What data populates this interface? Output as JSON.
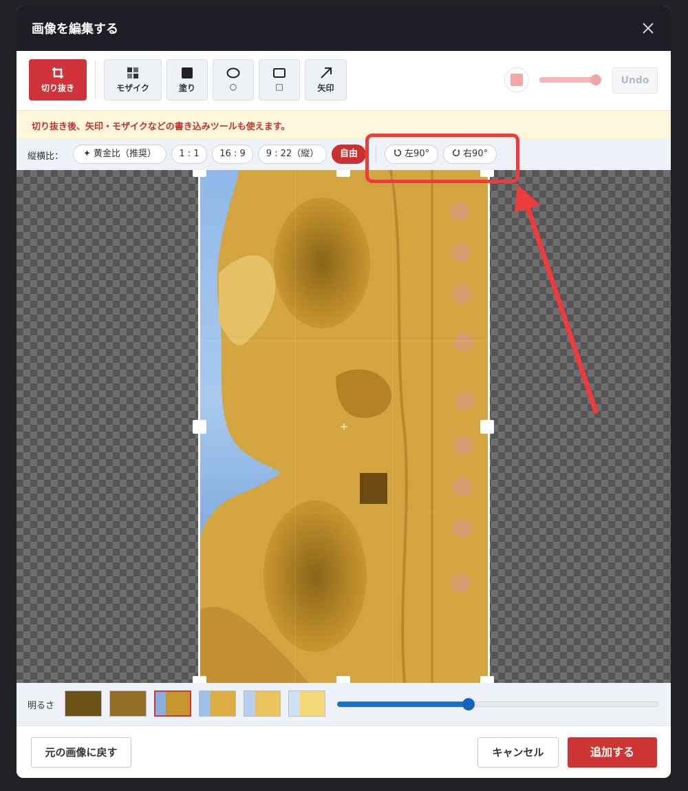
{
  "dialog": {
    "title": "画像を編集する"
  },
  "toolbar": {
    "tools": [
      {
        "label": "切り抜き",
        "icon": "crop-icon"
      },
      {
        "label": "モザイク",
        "icon": "mosaic-icon"
      },
      {
        "label": "塗り",
        "icon": "fill-icon"
      },
      {
        "label": "○",
        "icon": "ellipse-icon"
      },
      {
        "label": "□",
        "icon": "rectangle-icon"
      },
      {
        "label": "矢印",
        "icon": "arrow-icon"
      }
    ],
    "active_tool": "切り抜き",
    "color": "#f4a7a7",
    "undo_label": "Undo"
  },
  "notice": "切り抜き後、矢印・モザイクなどの書き込みツールも使えます。",
  "aspect": {
    "label": "縦横比：",
    "options": [
      "✦ 黄金比（推奨）",
      "1 : 1",
      "16 : 9",
      "9 : 22（縦）",
      "自由"
    ],
    "selected": "自由",
    "rotate_left": "左90°",
    "rotate_right": "右90°"
  },
  "brightness": {
    "label": "明るさ",
    "presets": 6,
    "selected_index": 2,
    "slider_value": 0.41
  },
  "footer": {
    "reset_label": "元の画像に戻す",
    "cancel_label": "キャンセル",
    "add_label": "追加する"
  },
  "colors": {
    "accent": "#cf3633",
    "title_bar": "#1e1f26",
    "highlight": "#ef3b3b",
    "slider": "#1565c0"
  }
}
